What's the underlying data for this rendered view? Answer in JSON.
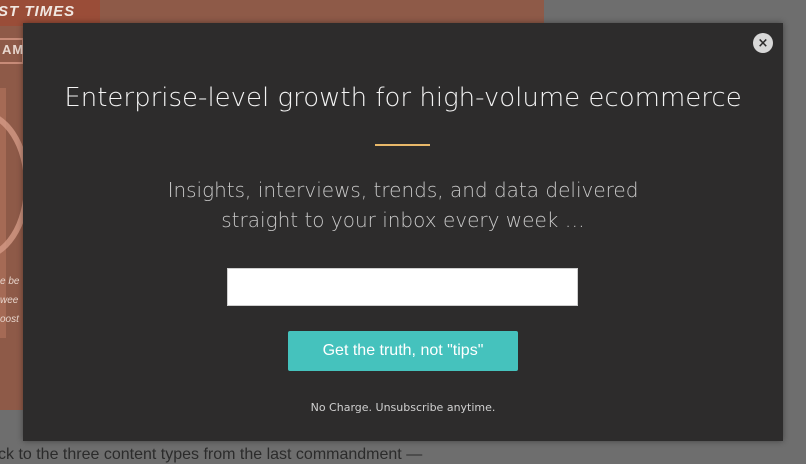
{
  "background_page": {
    "hero_label": "ST TIMES",
    "hero_tag": "AM",
    "hero_note_lines": [
      "e be",
      "wee",
      "oost"
    ],
    "article_text": "ck to the three content types from the last commandment —"
  },
  "modal": {
    "close_symbol": "×",
    "title": "Enterprise-level growth for high-volume ecommerce",
    "subtitle_line1": "Insights, interviews, trends, and data delivered",
    "subtitle_line2": "straight to your inbox every week …",
    "email_value": "",
    "email_placeholder": "",
    "cta_label": "Get the truth, not \"tips\"",
    "disclaimer": "No Charge. Unsubscribe anytime.",
    "colors": {
      "background": "#2d2c2c",
      "accent_divider": "#e8b869",
      "cta": "#45c2bd"
    }
  }
}
